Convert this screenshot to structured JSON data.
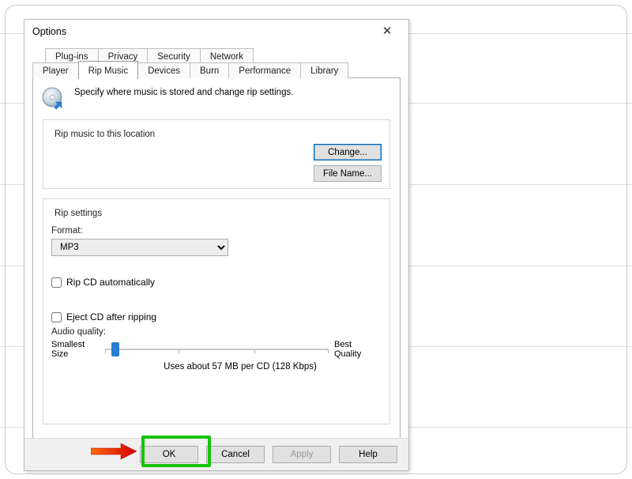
{
  "dialog": {
    "title": "Options",
    "close_glyph": "✕",
    "tabs_top": [
      "Plug-ins",
      "Privacy",
      "Security",
      "Network"
    ],
    "tabs_bottom": [
      "Player",
      "Rip Music",
      "Devices",
      "Burn",
      "Performance",
      "Library"
    ],
    "active_tab": "Rip Music",
    "intro": "Specify where music is stored and change rip settings.",
    "group_location": {
      "title": "Rip music to this location",
      "change_btn": "Change...",
      "filename_btn": "File Name..."
    },
    "group_settings": {
      "title": "Rip settings",
      "format_label": "Format:",
      "format_value": "MP3",
      "rip_auto_label": "Rip CD automatically",
      "rip_auto_checked": false,
      "eject_label": "Eject CD after ripping",
      "eject_checked": false,
      "quality_label": "Audio quality:",
      "slider_min_label": "Smallest\nSize",
      "slider_max_label": "Best\nQuality",
      "usage_text": "Uses about 57 MB per CD (128 Kbps)"
    },
    "buttons": {
      "ok": "OK",
      "cancel": "Cancel",
      "apply": "Apply",
      "help": "Help"
    }
  }
}
